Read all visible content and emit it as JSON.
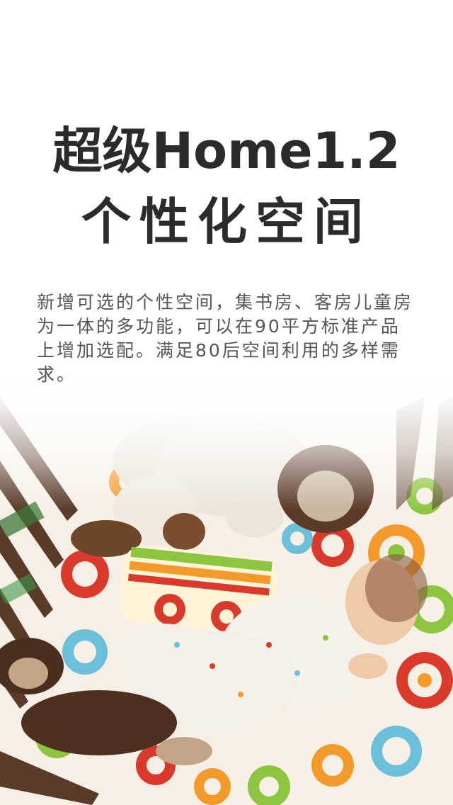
{
  "headline": {
    "line1": "超级Home1.2",
    "line2": "个性化空间"
  },
  "description": "新增可选的个性空间，集书房、客房儿童房为一体的多功能，可以在90平方标准产品上增加选配。满足80后空间利用的多样需求。",
  "colors": {
    "title": "#2b2b2b",
    "body": "#555555",
    "crib_wood": "#5a3b2a",
    "sheet_red": "#d93a2b",
    "sheet_green": "#8cc63f",
    "sheet_orange": "#f39a2b",
    "sheet_blue": "#6bbfd9"
  }
}
